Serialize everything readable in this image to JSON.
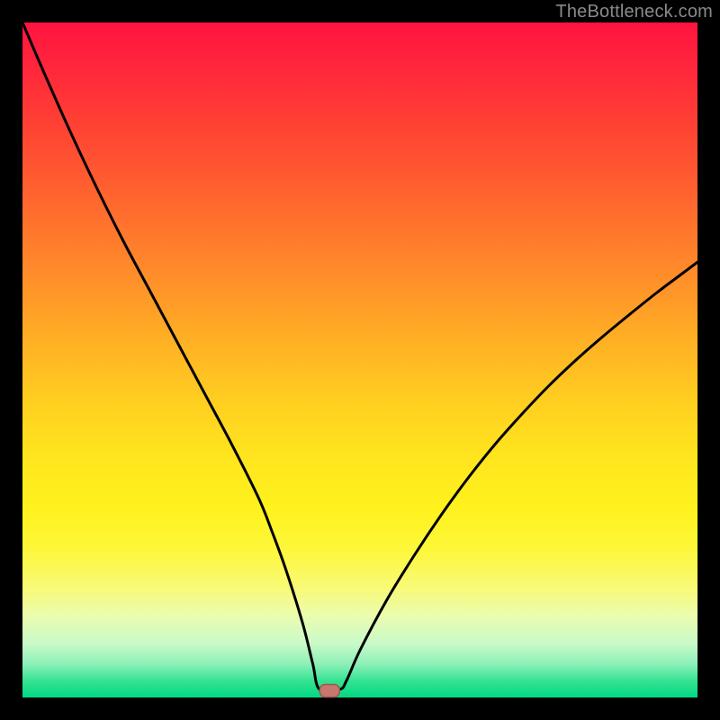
{
  "watermark": "TheBottleneck.com",
  "colors": {
    "black": "#000000",
    "curve": "#000000",
    "marker_fill": "#c7786e",
    "marker_stroke": "#a2564f"
  },
  "chart_data": {
    "type": "line",
    "title": "",
    "xlabel": "",
    "ylabel": "",
    "xlim": [
      0,
      100
    ],
    "ylim": [
      0,
      100
    ],
    "grid": false,
    "legend": false,
    "series": [
      {
        "name": "bottleneck-curve",
        "x": [
          0,
          3,
          7,
          11,
          15,
          19,
          23,
          27,
          31,
          35,
          37,
          39,
          41.5,
          43,
          44,
          47,
          48,
          50,
          54,
          58,
          62,
          66,
          70,
          74,
          78,
          82,
          86,
          90,
          94,
          98,
          100
        ],
        "values": [
          100,
          93,
          84,
          75.5,
          67.5,
          60,
          52.5,
          45,
          37.5,
          29.5,
          24.5,
          19,
          11,
          5,
          1.2,
          1.2,
          2.5,
          7,
          14.5,
          21,
          27,
          32.5,
          37.5,
          42,
          46.2,
          50,
          53.5,
          56.8,
          60,
          63,
          64.5
        ]
      }
    ],
    "annotations": [
      {
        "name": "optimal-marker",
        "x": 45.5,
        "y": 1.0,
        "shape": "rounded-rect"
      }
    ]
  }
}
